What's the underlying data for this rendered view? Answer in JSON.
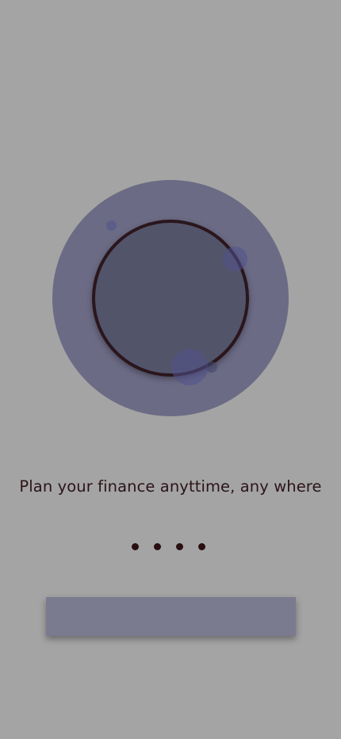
{
  "onboarding": {
    "tagline": "Plan your finance anyttime, any where",
    "page_indicator": {
      "total_pages": 4
    },
    "primary_button": {
      "label": ""
    }
  },
  "colors": {
    "background": "#a4a4a4",
    "illustration_halo": "#6c6b85",
    "ring_border": "#2a161c",
    "ring_fill": "#52546a",
    "button": "#7b7b8f",
    "text": "#2a1418"
  }
}
